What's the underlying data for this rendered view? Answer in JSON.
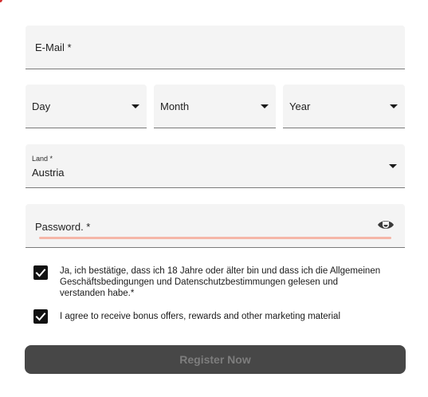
{
  "form": {
    "email": {
      "label": "E-Mail *"
    },
    "birthdate": {
      "day": {
        "label": "Day"
      },
      "month": {
        "label": "Month"
      },
      "year": {
        "label": "Year"
      }
    },
    "country": {
      "label": "Land *",
      "value": "Austria"
    },
    "password": {
      "label": "Password. *",
      "state": "error"
    },
    "consents": [
      {
        "text": "Ja, ich bestätige, dass ich 18 Jahre oder älter bin und dass ich die Allgemeinen Geschäftsbedingungen und Datenschutzbestimmungen gelesen und verstanden habe.*",
        "checked": true
      },
      {
        "text": "I agree to receive bonus offers, rewards and other marketing material",
        "checked": true
      }
    ],
    "submit": {
      "label": "Register Now",
      "enabled": false
    }
  },
  "icons": {
    "dropdown": "chevron-down-icon",
    "password_toggle": "eye-icon",
    "checkbox": "checkmark-icon"
  },
  "colors": {
    "field_background": "#f4f4f4",
    "error_underline": "#f5b6a8",
    "button_background": "#474747",
    "button_text": "#7d7d7d",
    "checkbox": "#111111"
  }
}
